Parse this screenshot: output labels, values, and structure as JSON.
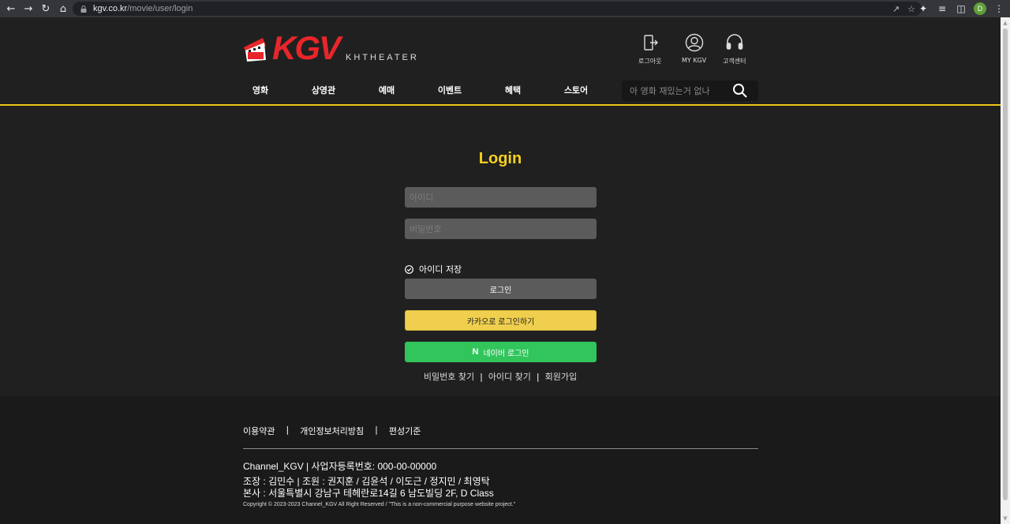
{
  "browser": {
    "url_domain": "kgv.co.kr",
    "url_path": "/movie/user/login",
    "profile_initial": "D"
  },
  "header": {
    "brand": "KGV",
    "subbrand": "KHTHEATER",
    "utils": [
      {
        "label": "로그아웃",
        "icon": "logout-icon"
      },
      {
        "label": "MY KGV",
        "icon": "user-icon"
      },
      {
        "label": "고객센터",
        "icon": "headset-icon"
      }
    ],
    "menu": [
      "영화",
      "상영관",
      "예매",
      "이벤트",
      "혜택",
      "스토어"
    ],
    "search_placeholder": "아 영화 재밌는거 없나"
  },
  "login": {
    "title": "Login",
    "id_placeholder": "아이디",
    "pw_placeholder": "비밀번호",
    "remember_label": "아이디 저장",
    "login_button": "로그인",
    "kakao_button": "카카오로 로그인하기",
    "naver_mark": "N",
    "naver_button": "네이버 로그인",
    "links": [
      "비밀번호 찾기",
      "아이디 찾기",
      "회원가입"
    ],
    "link_separator": "|"
  },
  "footer": {
    "policies": [
      "이용약관",
      "개인정보처리방침",
      "편성기준"
    ],
    "separator": "|",
    "company": "Channel_KGV | 사업자등록번호: 000-00-00000",
    "members": "조장 : 김민수 | 조원 : 권지훈 / 김윤석 / 이도근 / 정지민 / 최영탁",
    "address": "본사 : 서울특별시 강남구 테헤란로14길 6 남도빌딩 2F, D Class",
    "copyright": "Copyright © 2023-2023 Channel_KGV All Right Reserved / \"This is a non-commercial purpose website project.\""
  },
  "colors": {
    "accent": "#f0c419",
    "brand_red": "#e8262a",
    "kakao": "#efcf4d",
    "naver": "#31c55c"
  }
}
